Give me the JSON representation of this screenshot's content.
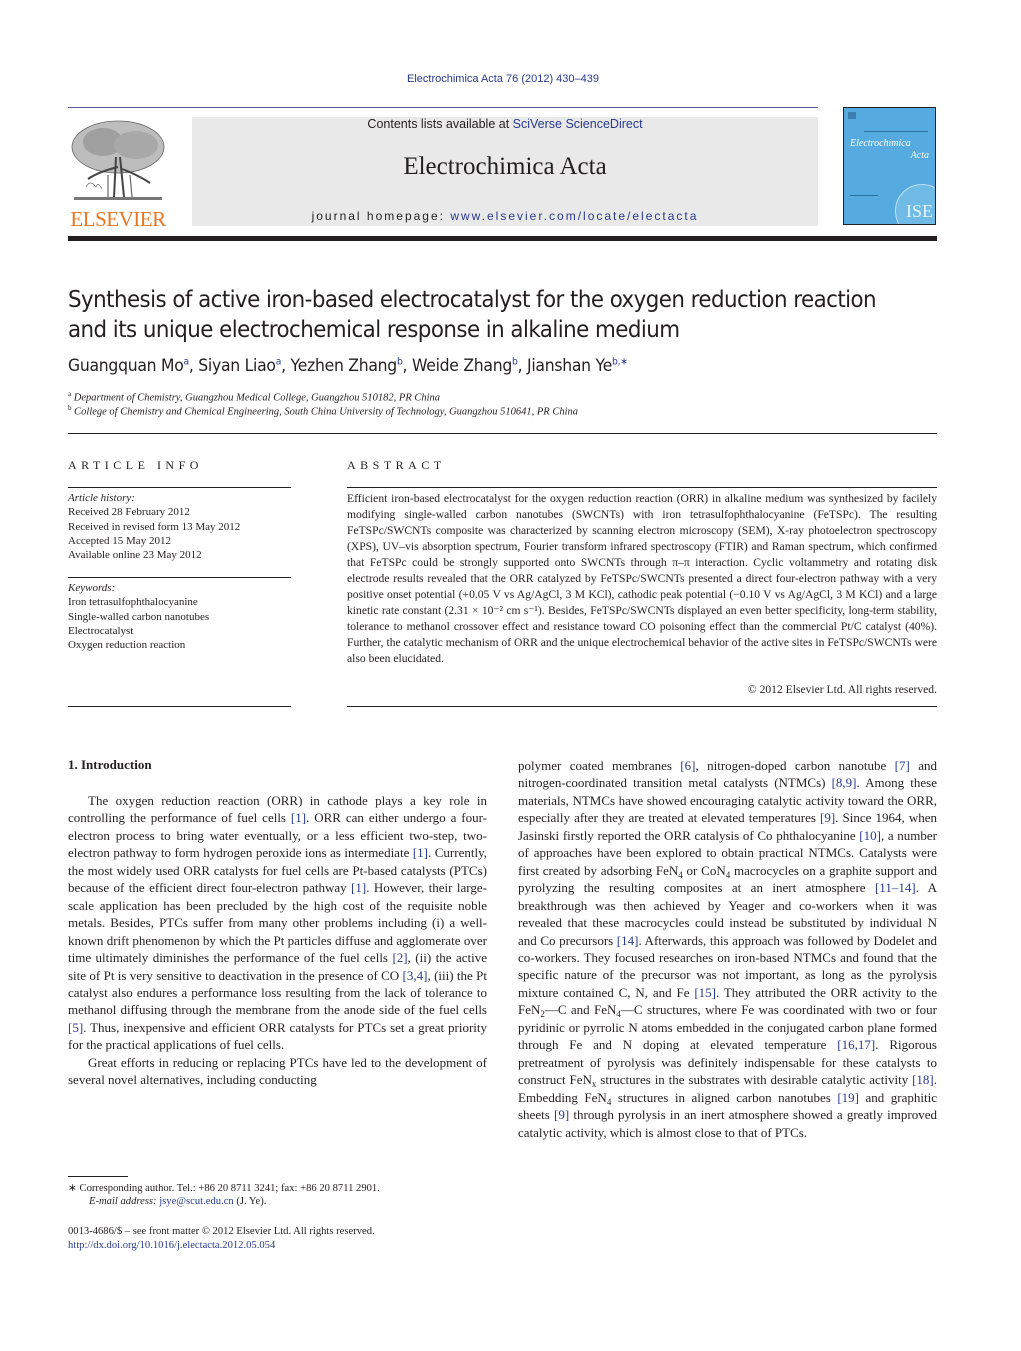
{
  "header": {
    "running_head": "Electrochimica Acta 76 (2012) 430–439",
    "contents_prefix": "Contents lists available at ",
    "contents_link": "SciVerse ScienceDirect",
    "journal_title": "Electrochimica Acta",
    "homepage_prefix": "journal homepage: ",
    "homepage_link": "www.elsevier.com/locate/electacta",
    "publisher_logo_text": "ELSEVIER",
    "cover": {
      "title_line1": "Electrochimica",
      "title_line2": "Acta",
      "seal_text": "ISE",
      "color": "#55aadf"
    }
  },
  "article": {
    "title": "Synthesis of active iron-based electrocatalyst for the oxygen reduction reaction and its unique electrochemical response in alkaline medium",
    "authors": [
      {
        "name": "Guangquan Mo",
        "affil": "a",
        "sep": ", "
      },
      {
        "name": "Siyan Liao",
        "affil": "a",
        "sep": ", "
      },
      {
        "name": "Yezhen Zhang",
        "affil": "b",
        "sep": ", "
      },
      {
        "name": "Weide Zhang",
        "affil": "b",
        "sep": ", "
      },
      {
        "name": "Jianshan Ye",
        "affil": "b,∗",
        "sep": ""
      }
    ],
    "affiliations": [
      {
        "key": "a",
        "text": "Department of Chemistry, Guangzhou Medical College, Guangzhou 510182, PR China"
      },
      {
        "key": "b",
        "text": "College of Chemistry and Chemical Engineering, South China University of Technology, Guangzhou 510641, PR China"
      }
    ]
  },
  "article_info": {
    "heading": "ARTICLE INFO",
    "history_label": "Article history:",
    "history": [
      "Received 28 February 2012",
      "Received in revised form 13 May 2012",
      "Accepted 15 May 2012",
      "Available online 23 May 2012"
    ],
    "keywords_label": "Keywords:",
    "keywords": [
      "Iron tetrasulfophthalocyanine",
      "Single-walled carbon nanotubes",
      "Electrocatalyst",
      "Oxygen reduction reaction"
    ]
  },
  "abstract": {
    "heading": "ABSTRACT",
    "text": "Efficient iron-based electrocatalyst for the oxygen reduction reaction (ORR) in alkaline medium was synthesized by facilely modifying single-walled carbon nanotubes (SWCNTs) with iron tetrasulfophthalocyanine (FeTSPc). The resulting FeTSPc/SWCNTs composite was characterized by scanning electron microscopy (SEM), X-ray photoelectron spectroscopy (XPS), UV–vis absorption spectrum, Fourier transform infrared spectroscopy (FTIR) and Raman spectrum, which confirmed that FeTSPc could be strongly supported onto SWCNTs through π–π interaction. Cyclic voltammetry and rotating disk electrode results revealed that the ORR catalyzed by FeTSPc/SWCNTs presented a direct four-electron pathway with a very positive onset potential (+0.05 V vs Ag/AgCl, 3 M KCl), cathodic peak potential (−0.10 V vs Ag/AgCl, 3 M KCl) and a large kinetic rate constant (2.31 × 10⁻² cm s⁻¹). Besides, FeTSPc/SWCNTs displayed an even better specificity, long-term stability, tolerance to methanol crossover effect and resistance toward CO poisoning effect than the commercial Pt/C catalyst (40%). Further, the catalytic mechanism of ORR and the unique electrochemical behavior of the active sites in FeTSPc/SWCNTs were also been elucidated.",
    "copyright": "© 2012 Elsevier Ltd. All rights reserved."
  },
  "body": {
    "section_heading": "1.  Introduction",
    "left_column": [
      {
        "indent": true,
        "segments": [
          {
            "t": "The oxygen reduction reaction (ORR) in cathode plays a key role in controlling the performance of fuel cells "
          },
          {
            "ref": "[1]"
          },
          {
            "t": ". ORR can either undergo a four-electron process to bring water eventually, or a less efficient two-step, two-electron pathway to form hydrogen peroxide ions as intermediate "
          },
          {
            "ref": "[1]"
          },
          {
            "t": ". Currently, the most widely used ORR catalysts for fuel cells are Pt-based catalysts (PTCs) because of the efficient direct four-electron pathway "
          },
          {
            "ref": "[1]"
          },
          {
            "t": ". However, their large-scale application has been precluded by the high cost of the requisite noble metals. Besides, PTCs suffer from many other problems including (i) a well-known drift phenomenon by which the Pt particles diffuse and agglomerate over time ultimately diminishes the performance of the fuel cells "
          },
          {
            "ref": "[2]"
          },
          {
            "t": ", (ii) the active site of Pt is very sensitive to deactivation in the presence of CO "
          },
          {
            "ref": "[3,4]"
          },
          {
            "t": ", (iii) the Pt catalyst also endures a performance loss resulting from the lack of tolerance to methanol diffusing through the membrane from the anode side of the fuel cells "
          },
          {
            "ref": "[5]"
          },
          {
            "t": ". Thus, inexpensive and efficient ORR catalysts for PTCs set a great priority for the practical applications of fuel cells."
          }
        ]
      },
      {
        "indent": true,
        "segments": [
          {
            "t": "Great efforts in reducing or replacing PTCs have led to the development of several novel alternatives, including conducting"
          }
        ]
      }
    ],
    "right_column": [
      {
        "indent": false,
        "segments": [
          {
            "t": "polymer coated membranes "
          },
          {
            "ref": "[6]"
          },
          {
            "t": ", nitrogen-doped carbon nanotube "
          },
          {
            "ref": "[7]"
          },
          {
            "t": " and nitrogen-coordinated transition metal catalysts (NTMCs) "
          },
          {
            "ref": "[8,9]"
          },
          {
            "t": ". Among these materials, NTMCs have showed encouraging catalytic activity toward the ORR, especially after they are treated at elevated temperatures "
          },
          {
            "ref": "[9]"
          },
          {
            "t": ". Since 1964, when Jasinski firstly reported the ORR catalysis of Co phthalocyanine "
          },
          {
            "ref": "[10]"
          },
          {
            "t": ", a number of approaches have been explored to obtain practical NTMCs. Catalysts were first created by adsorbing FeN"
          },
          {
            "sub": "4"
          },
          {
            "t": " or CoN"
          },
          {
            "sub": "4"
          },
          {
            "t": " macrocycles on a graphite support and pyrolyzing the resulting composites at an inert atmosphere "
          },
          {
            "ref": "[11–14]"
          },
          {
            "t": ". A breakthrough was then achieved by Yeager and co-workers when it was revealed that these macrocycles could instead be substituted by individual N and Co precursors "
          },
          {
            "ref": "[14]"
          },
          {
            "t": ". Afterwards, this approach was followed by Dodelet and co-workers. They focused researches on iron-based NTMCs and found that the specific nature of the precursor was not important, as long as the pyrolysis mixture contained C, N, and Fe "
          },
          {
            "ref": "[15]"
          },
          {
            "t": ". They attributed the ORR activity to the FeN"
          },
          {
            "sub": "2"
          },
          {
            "t": "—C and FeN"
          },
          {
            "sub": "4"
          },
          {
            "t": "—C structures, where Fe was coordinated with two or four pyridinic or pyrrolic N atoms embedded in the conjugated carbon plane formed through Fe and N doping at elevated temperature "
          },
          {
            "ref": "[16,17]"
          },
          {
            "t": ". Rigorous pretreatment of pyrolysis was definitely indispensable for these catalysts to construct FeN"
          },
          {
            "sub": "x"
          },
          {
            "t": " structures in the substrates with desirable catalytic activity "
          },
          {
            "ref": "[18]"
          },
          {
            "t": ". Embedding FeN"
          },
          {
            "sub": "4"
          },
          {
            "t": " structures in aligned carbon nanotubes "
          },
          {
            "ref": "[19]"
          },
          {
            "t": " and graphitic sheets "
          },
          {
            "ref": "[9]"
          },
          {
            "t": " through pyrolysis in an inert atmosphere showed a greatly improved catalytic activity, which is almost close to that of PTCs."
          }
        ]
      }
    ]
  },
  "footnotes": {
    "corresponding": "∗  Corresponding author. Tel.: +86 20 8711 3241; fax: +86 20 8711 2901.",
    "email_label": "E-mail address: ",
    "email": "jsye@scut.edu.cn",
    "email_suffix": " (J. Ye).",
    "issn_line": "0013-4686/$ – see front matter © 2012 Elsevier Ltd. All rights reserved.",
    "doi": "http://dx.doi.org/10.1016/j.electacta.2012.05.054"
  },
  "colors": {
    "link": "#2a3a8c",
    "elsevier_orange": "#e87722",
    "banner_bg": "#e9e9ea",
    "cover_blue": "#55aadf"
  }
}
